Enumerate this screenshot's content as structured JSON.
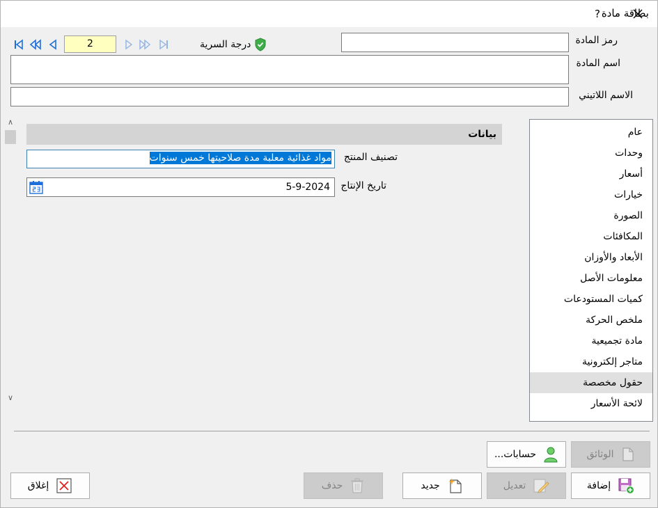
{
  "window": {
    "title": "بطاقة مادة",
    "help": "?"
  },
  "header_fields": {
    "code_label": "رمز المادة",
    "name_label": "اسم المادة",
    "latin_name_label": "الاسم اللاتيني",
    "code_value": "",
    "name_value": "",
    "latin_name_value": ""
  },
  "navigator": {
    "record_number": "2"
  },
  "secrecy": {
    "label": "درجة السرية"
  },
  "section": {
    "title": "بيانات"
  },
  "product_fields": {
    "classification_label": "تصنيف المنتج",
    "classification_value": "مواد غذائية معلبة مدة صلاحيتها خمس سنوات",
    "production_date_label": "تاريخ الإنتاج",
    "production_date_value": "5-9-2024"
  },
  "side_list": {
    "items": [
      "عام",
      "وحدات",
      "أسعار",
      "خيارات",
      "الصورة",
      "المكافئات",
      "الأبعاد والأوزان",
      "معلومات الأصل",
      "كميات المستودعات",
      "ملخص الحركة",
      "مادة تجميعية",
      "متاجر إلكترونية",
      "حقول مخصصة",
      "لائحة الأسعار"
    ],
    "selected_index": 12
  },
  "buttons": {
    "documents": "الوثائق",
    "accounts": "حسابات...",
    "add": "إضافة",
    "edit": "تعديل",
    "new": "جديد",
    "delete": "حذف",
    "close": "إغلاق"
  },
  "colors": {
    "selection": "#0078d7",
    "record_bg": "#ffffc0",
    "nav_blue": "#1e6fd9",
    "shield_green": "#3fae49"
  }
}
